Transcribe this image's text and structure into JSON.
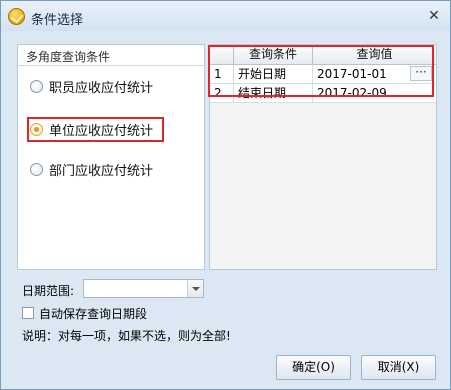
{
  "window": {
    "title": "条件选择",
    "close_glyph": "✕"
  },
  "group": {
    "title": "多角度查询条件",
    "options": [
      {
        "label": "职员应收应付统计",
        "checked": false
      },
      {
        "label": "单位应收应付统计",
        "checked": true
      },
      {
        "label": "部门应收应付统计",
        "checked": false
      }
    ]
  },
  "grid": {
    "columns": [
      "",
      "查询条件",
      "查询值"
    ],
    "rows": [
      {
        "index": "1",
        "condition": "开始日期",
        "value": "2017-01-01"
      },
      {
        "index": "2",
        "condition": "结束日期",
        "value": "2017-02-09"
      }
    ],
    "ellipsis": "···"
  },
  "date_range": {
    "label": "日期范围:",
    "value": ""
  },
  "auto_save": {
    "label": "自动保存查询日期段",
    "checked": false
  },
  "note": "说明：对每一项，如果不选，则为全部!",
  "buttons": {
    "ok": "确定(O)",
    "cancel": "取消(X)"
  }
}
